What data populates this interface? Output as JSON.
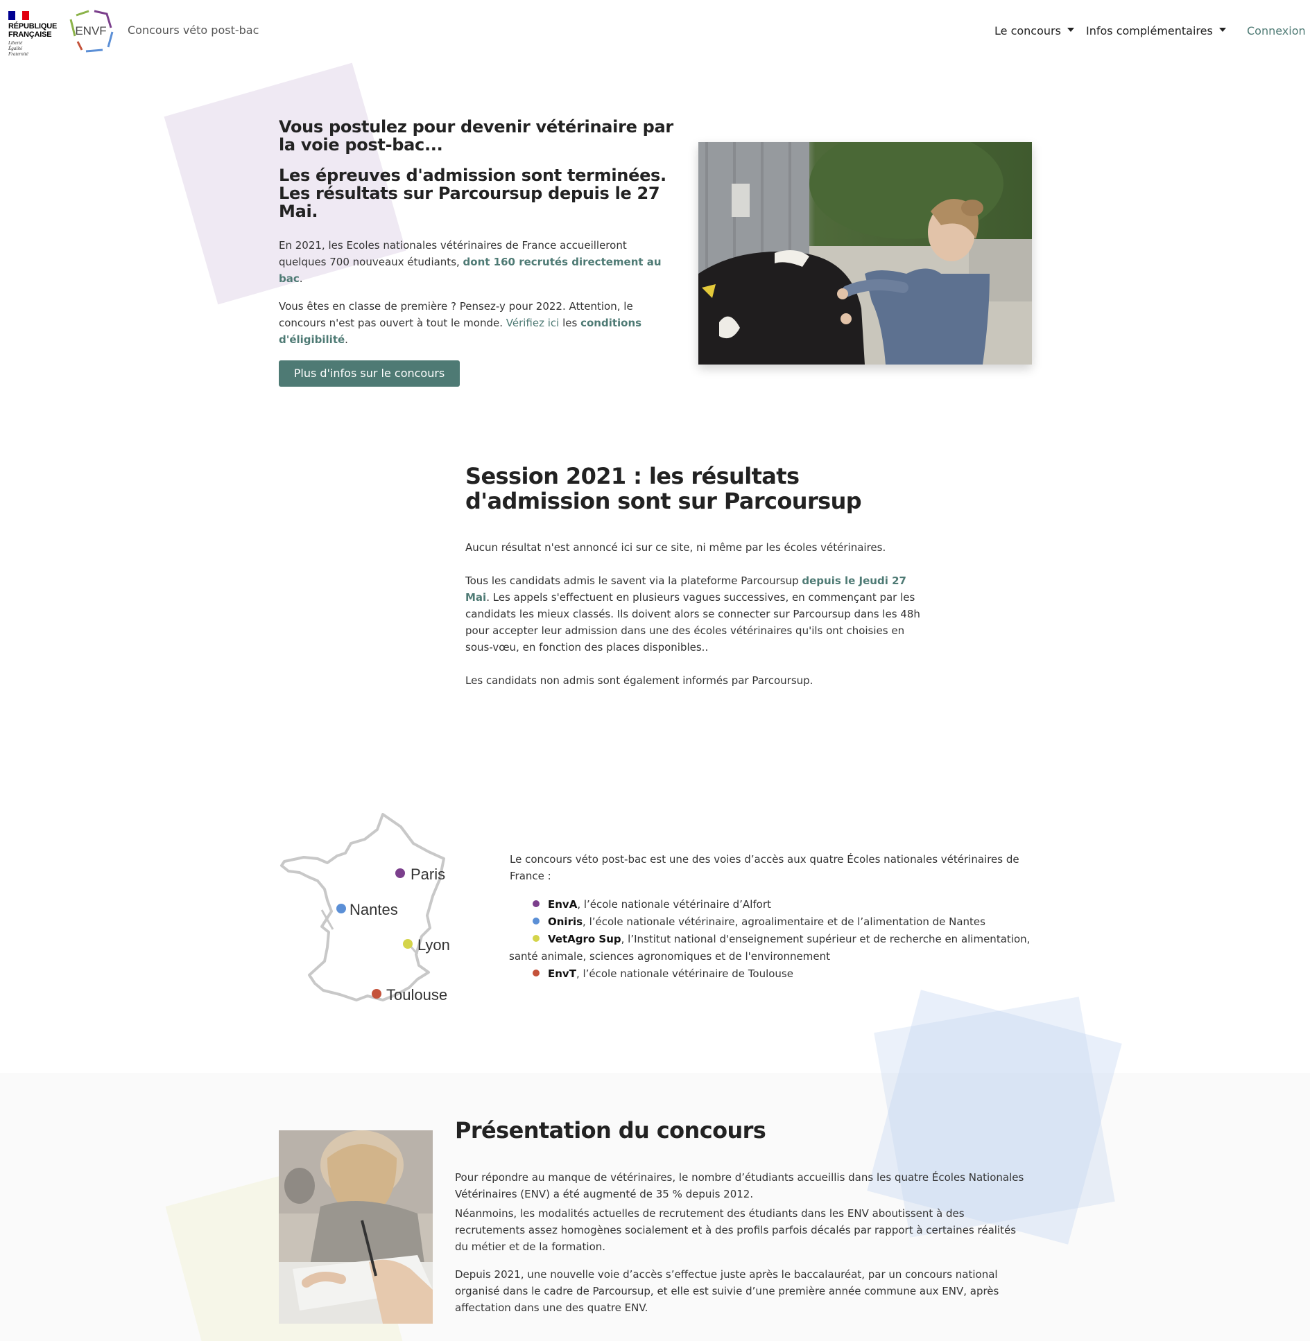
{
  "navbar": {
    "rf_title_line1": "RÉPUBLIQUE",
    "rf_title_line2": "FRANÇAISE",
    "rf_motto_line1": "Liberté",
    "rf_motto_line2": "Égalité",
    "rf_motto_line3": "Fraternité",
    "envf_logo_text": "ENVF",
    "brand": "Concours véto post-bac",
    "menu": [
      {
        "label": "Le concours"
      },
      {
        "label": "Infos complémentaires"
      }
    ],
    "login": "Connexion"
  },
  "hero": {
    "title1": "Vous postulez pour devenir vétérinaire par la voie post-bac...",
    "title2": "Les épreuves d'admission sont terminées. Les résultats sur Parcoursup depuis le 27 Mai.",
    "p1_text": "En 2021, les Ecoles nationales vétérinaires de France accueilleront quelques 700 nouveaux étudiants, ",
    "p1_bold": "dont 160 recrutés directement au bac",
    "p1_end": ".",
    "p2_text": "Vous êtes en classe de première ? Pensez-y pour 2022. Attention, le concours n'est pas ouvert à tout le monde. ",
    "p2_link": "Vérifiez ici",
    "p2_mid": " les ",
    "p2_bold": "conditions d'éligibilité",
    "p2_end": ".",
    "button": "Plus d'infos sur le concours"
  },
  "session": {
    "title": "Session 2021 : les résultats d'admission sont sur Parcoursup",
    "p1": "Aucun résultat n'est annoncé ici sur ce site, ni même par les écoles vétérinaires.",
    "p2_text": "Tous les candidats admis le savent via la plateforme Parcoursup ",
    "p2_bold": "depuis le Jeudi 27 Mai",
    "p2_end": ". Les appels s'effectuent en plusieurs vagues successives, en commençant par les candidats les mieux classés. Ils doivent alors se connecter sur Parcoursup dans les 48h pour accepter leur admission dans une des écoles vétérinaires qu'ils ont choisies en sous-vœu, en fonction des places disponibles..",
    "p3": "Les candidats non admis sont également informés par Parcoursup."
  },
  "schools": {
    "map_cities": [
      {
        "name": "Paris",
        "color": "#7b3f8c"
      },
      {
        "name": "Nantes",
        "color": "#5b8fd6"
      },
      {
        "name": "Lyon",
        "color": "#d4d44a"
      },
      {
        "name": "Toulouse",
        "color": "#c4523a"
      }
    ],
    "intro": "Le concours véto post-bac est une des voies d’accès aux quatre Écoles nationales vétérinaires de France :",
    "list": [
      {
        "name": "EnvA",
        "desc": ", l’école nationale vétérinaire d’Alfort",
        "color": "#7b3f8c"
      },
      {
        "name": "Oniris",
        "desc": ", l’école nationale vétérinaire, agroalimentaire et de l’alimentation de Nantes",
        "color": "#5b8fd6"
      },
      {
        "name": "VetAgro Sup",
        "desc": ", l’Institut national d'enseignement supérieur et de recherche en alimentation, santé animale, sciences agronomiques et de l'environnement",
        "color": "#d4d44a"
      },
      {
        "name": "EnvT",
        "desc": ", l’école nationale vétérinaire de Toulouse",
        "color": "#c4523a"
      }
    ]
  },
  "presentation": {
    "title": "Présentation du concours",
    "p1": "Pour répondre au manque de vétérinaires, le nombre d’étudiants accueillis dans les quatre Écoles Nationales Vétérinaires (ENV) a été augmenté de 35 % depuis 2012.",
    "p2": "Néanmoins, les modalités actuelles de recrutement des étudiants dans les ENV aboutissent à des recrutements assez homogènes socialement et à des profils parfois décalés par rapport à certaines réalités du métier et de la formation.",
    "p3": "Depuis 2021, une nouvelle voie d’accès s’effectue juste après le baccalauréat, par un concours national organisé dans le cadre de Parcoursup, et elle est suivie d’une première année commune aux ENV, après affectation dans une des quatre ENV."
  }
}
